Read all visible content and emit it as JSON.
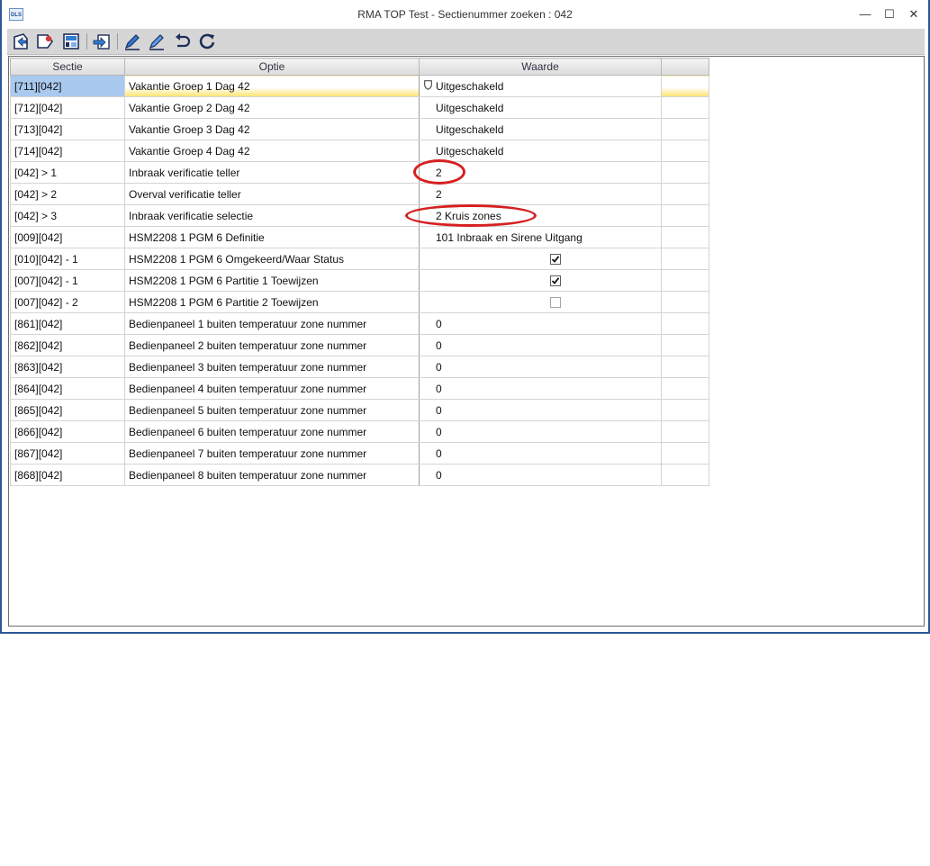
{
  "window": {
    "title": "RMA TOP Test - Sectienummer zoeken : 042",
    "app_icon_text": "DLS",
    "minimize": "—",
    "maximize": "☐",
    "close": "✕"
  },
  "toolbar": {
    "icons": [
      "upload-icon",
      "tag-icon",
      "panel-icon",
      "transfer-icon",
      "edit-icon",
      "edit-alt-icon",
      "undo-icon",
      "refresh-icon"
    ]
  },
  "grid": {
    "headers": [
      "Sectie",
      "Optie",
      "Waarde",
      ""
    ],
    "rows": [
      {
        "sectie": "[711][042]",
        "optie": "Vakantie Groep 1 Dag 42",
        "waarde": "Uitgeschakeld"
      },
      {
        "sectie": "[712][042]",
        "optie": "Vakantie Groep 2 Dag 42",
        "waarde": "Uitgeschakeld"
      },
      {
        "sectie": "[713][042]",
        "optie": "Vakantie Groep 3 Dag 42",
        "waarde": "Uitgeschakeld"
      },
      {
        "sectie": "[714][042]",
        "optie": "Vakantie Groep 4 Dag 42",
        "waarde": "Uitgeschakeld"
      },
      {
        "sectie": "[042] > 1",
        "optie": "Inbraak verificatie teller",
        "waarde": "2"
      },
      {
        "sectie": "[042] > 2",
        "optie": "Overval verificatie teller",
        "waarde": "2"
      },
      {
        "sectie": "[042] > 3",
        "optie": "Inbraak verificatie selectie",
        "waarde": "2 Kruis zones"
      },
      {
        "sectie": "[009][042]",
        "optie": "HSM2208 1 PGM 6 Definitie",
        "waarde": "101 Inbraak en Sirene Uitgang"
      },
      {
        "sectie": "[010][042] - 1",
        "optie": "HSM2208 1 PGM 6 Omgekeerd/Waar Status",
        "checked": true
      },
      {
        "sectie": "[007][042] - 1",
        "optie": "HSM2208 1 PGM 6 Partitie 1 Toewijzen",
        "checked": true
      },
      {
        "sectie": "[007][042] - 2",
        "optie": "HSM2208 1 PGM 6 Partitie 2 Toewijzen",
        "checked": false
      },
      {
        "sectie": "[861][042]",
        "optie": "Bedienpaneel 1 buiten temperatuur zone nummer",
        "waarde": "0"
      },
      {
        "sectie": "[862][042]",
        "optie": "Bedienpaneel 2 buiten temperatuur zone nummer",
        "waarde": "0"
      },
      {
        "sectie": "[863][042]",
        "optie": "Bedienpaneel 3 buiten temperatuur zone nummer",
        "waarde": "0"
      },
      {
        "sectie": "[864][042]",
        "optie": "Bedienpaneel 4 buiten temperatuur zone nummer",
        "waarde": "0"
      },
      {
        "sectie": "[865][042]",
        "optie": "Bedienpaneel 5 buiten temperatuur zone nummer",
        "waarde": "0"
      },
      {
        "sectie": "[866][042]",
        "optie": "Bedienpaneel 6 buiten temperatuur zone nummer",
        "waarde": "0"
      },
      {
        "sectie": "[867][042]",
        "optie": "Bedienpaneel 7 buiten temperatuur zone nummer",
        "waarde": "0"
      },
      {
        "sectie": "[868][042]",
        "optie": "Bedienpaneel 8 buiten temperatuur zone nummer",
        "waarde": "0"
      }
    ]
  },
  "colors": {
    "selection_blue": "#a9c9ef",
    "selection_yellow": "#ffe36b",
    "annotation_red": "#d62020",
    "window_border": "#2b5797"
  }
}
